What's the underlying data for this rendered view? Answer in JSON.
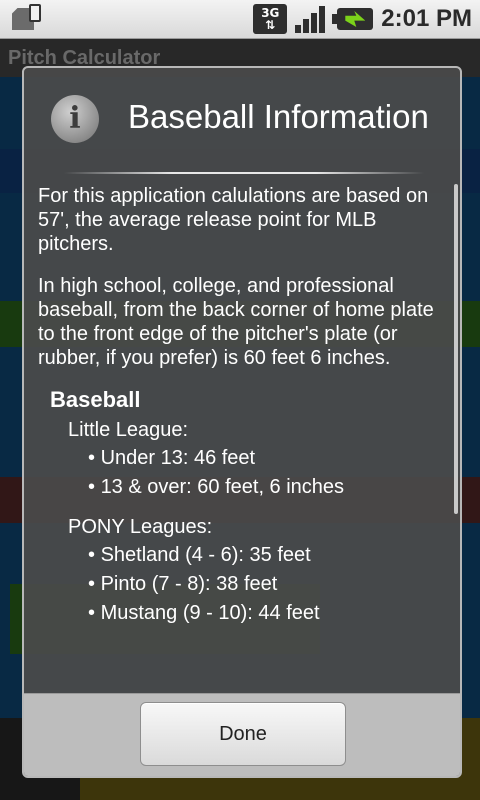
{
  "status_bar": {
    "network_type": "3G",
    "clock": "2:01 PM",
    "icons": [
      "sd-card-alert-icon",
      "network-3g-icon",
      "signal-strength-icon",
      "battery-charging-icon"
    ]
  },
  "background_app": {
    "title": "Pitch Calculator"
  },
  "dialog": {
    "title": "Baseball Information",
    "icon": "info-icon",
    "paragraphs": [
      "For this application calulations are based on 57', the average release point for MLB pitchers.",
      "In high school, college, and professional baseball, from the back corner of home plate to the front edge of the pitcher's plate (or rubber, if you prefer) is 60 feet 6 inches."
    ],
    "section_title": "Baseball",
    "leagues": [
      {
        "name": "Little League:",
        "rules": [
          "Under 13: 46 feet",
          "13 & over: 60 feet, 6 inches"
        ]
      },
      {
        "name": "PONY Leagues:",
        "rules": [
          "Shetland (4 - 6): 35 feet",
          "Pinto (7 - 8): 38 feet",
          "Mustang (9 - 10): 44 feet"
        ]
      }
    ],
    "done_label": "Done"
  }
}
